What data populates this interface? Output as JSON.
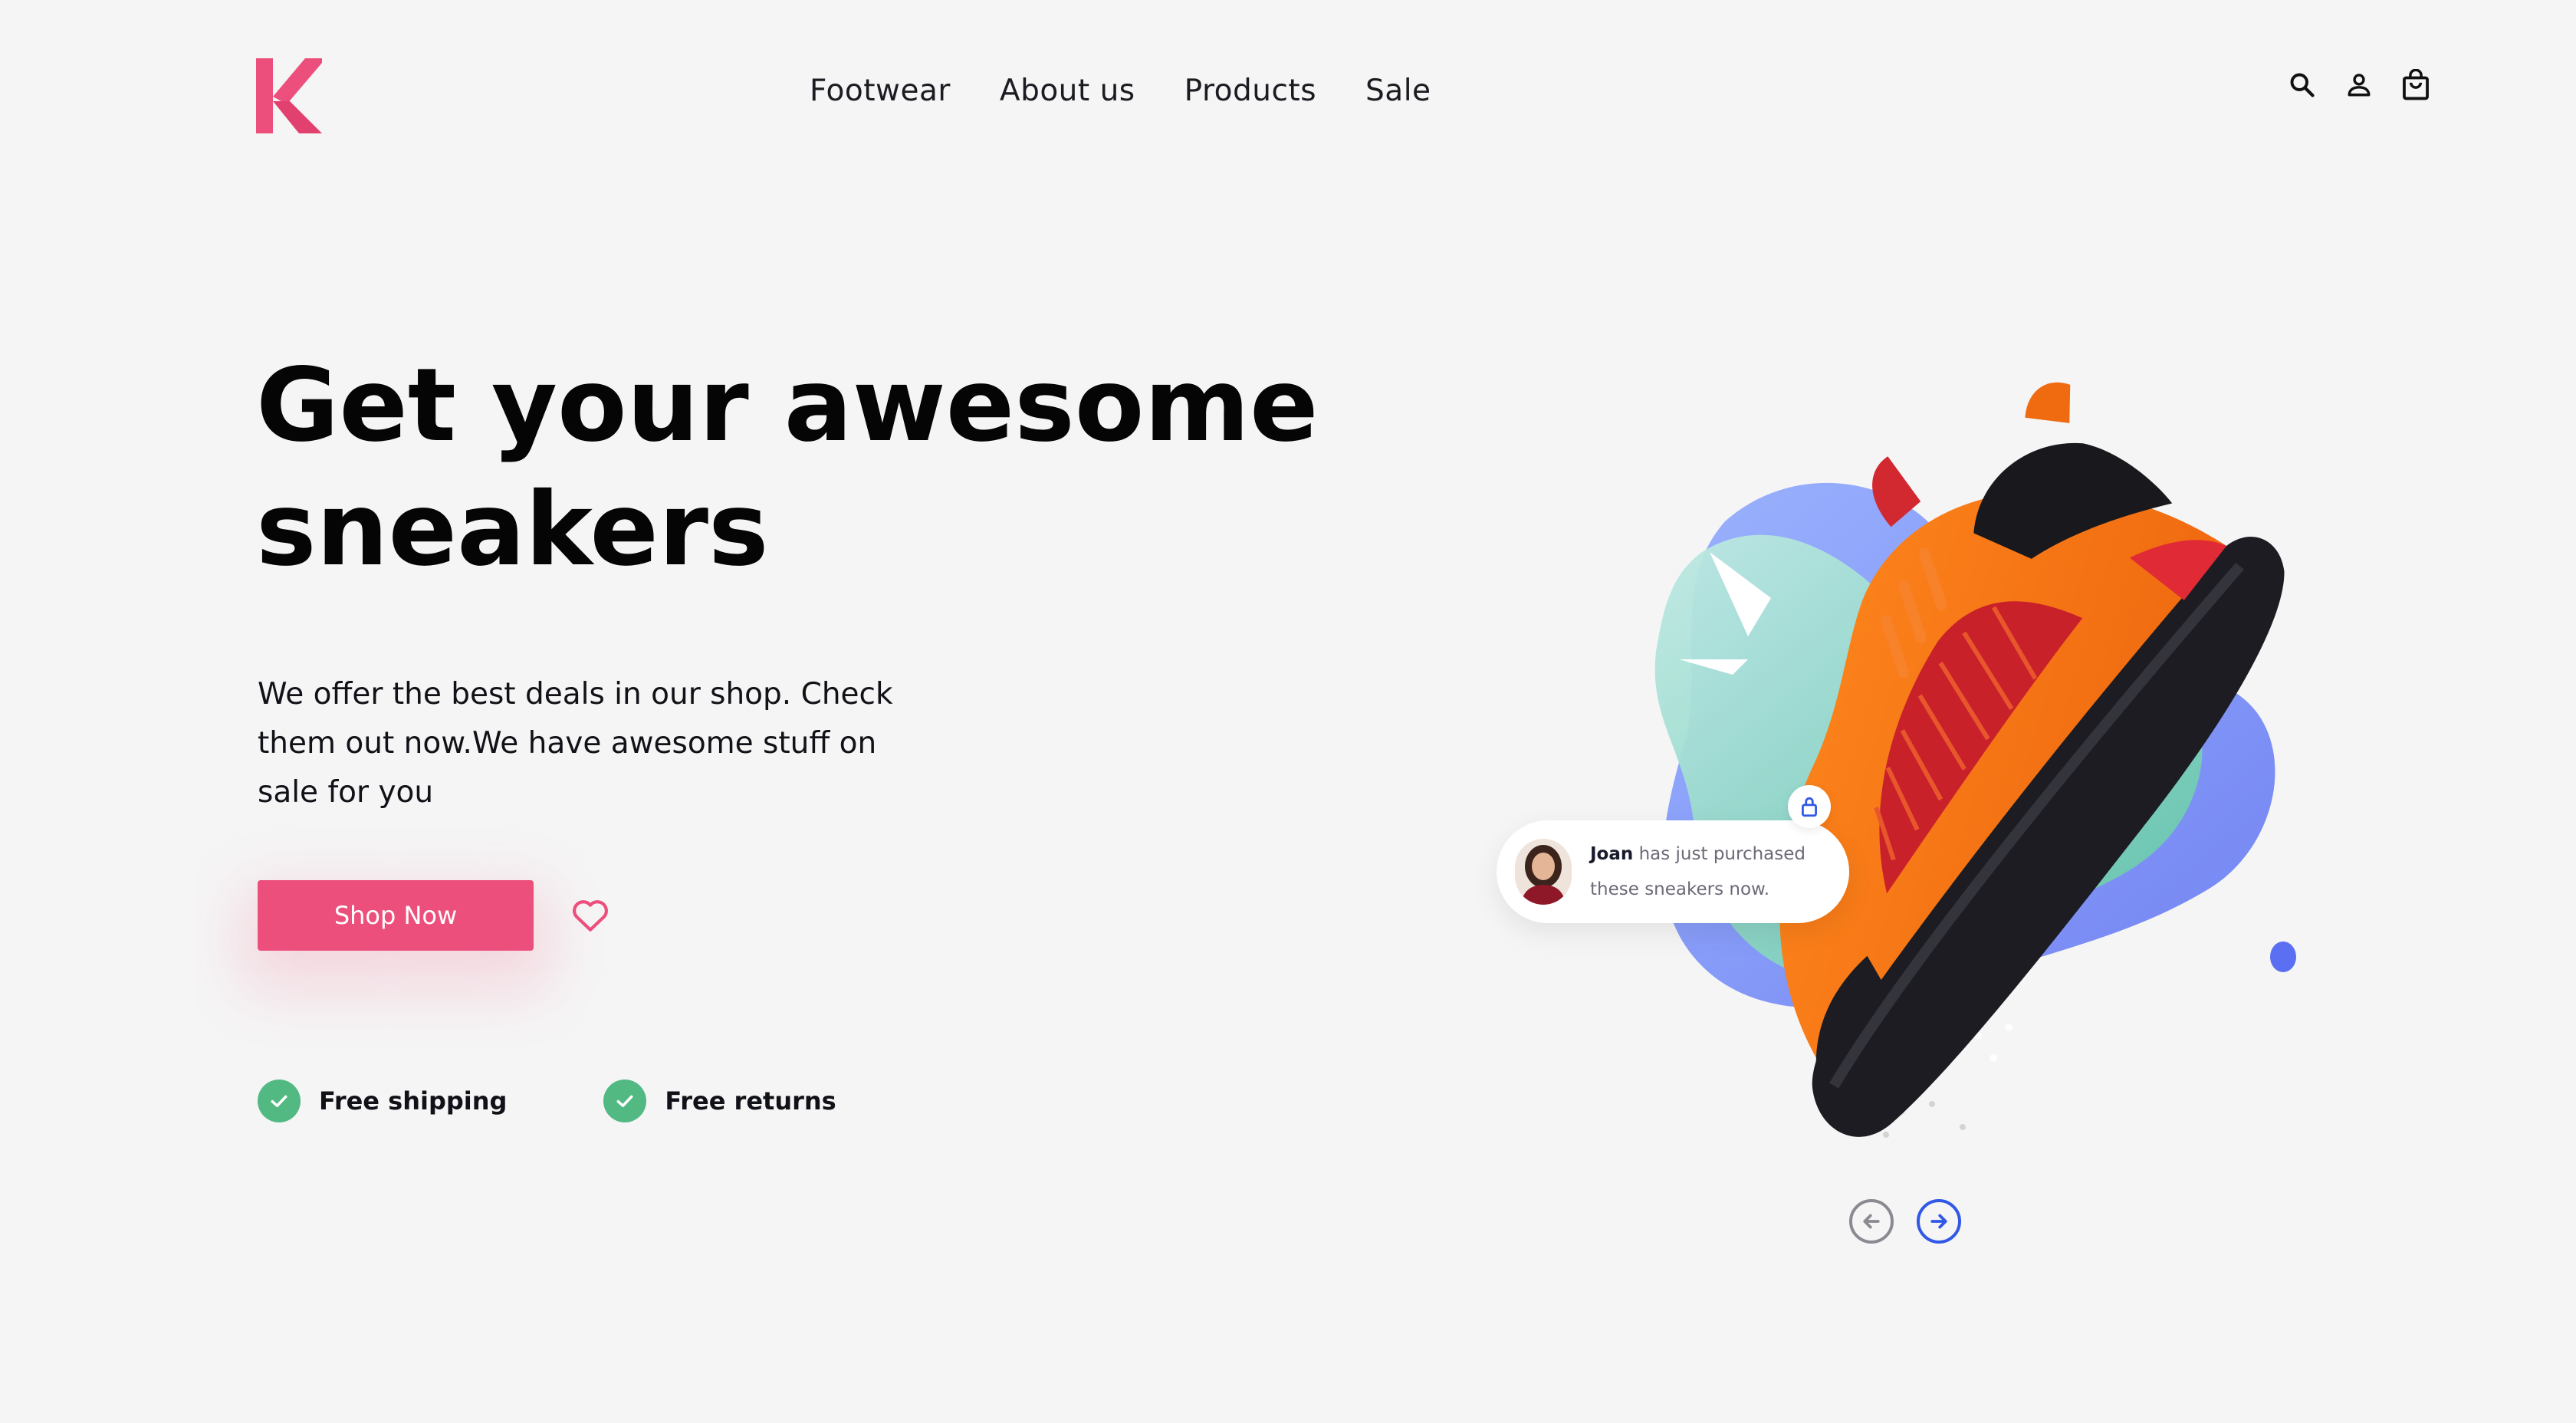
{
  "brand": {
    "logo_icon": "k-logo-icon",
    "color": "#ec4f7c"
  },
  "nav": {
    "items": [
      {
        "label": "Footwear"
      },
      {
        "label": "About us"
      },
      {
        "label": "Products"
      },
      {
        "label": "Sale"
      }
    ]
  },
  "header_icons": [
    "search-icon",
    "user-icon",
    "shopping-bag-icon"
  ],
  "hero": {
    "title_line1": "Get your awesome",
    "title_line2": "sneakers",
    "description": "We offer the best deals in our shop. Check them out now.We have awesome stuff on sale for you",
    "cta_label": "Shop Now",
    "cta_color": "#ec4f7c"
  },
  "features": [
    {
      "label": "Free shipping",
      "icon": "check-icon"
    },
    {
      "label": "Free returns",
      "icon": "check-icon"
    }
  ],
  "notification": {
    "name": "Joan",
    "message": "has just purchased these sneakers now."
  },
  "slider": {
    "prev_icon": "arrow-left-icon",
    "next_icon": "arrow-right-icon",
    "active_color": "#3158e6"
  },
  "colors": {
    "check": "#52b983",
    "background": "#f5f5f5"
  }
}
